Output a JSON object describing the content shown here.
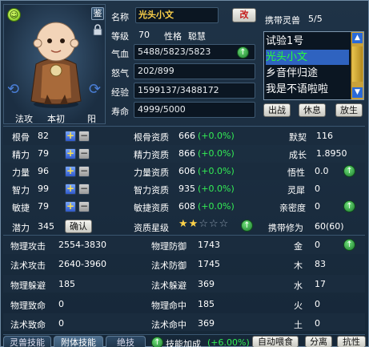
{
  "portrait": {
    "mood_icon": "smiley-face-icon",
    "appraise_char": "鉴",
    "lock_icon": "lock-icon"
  },
  "pet_labels": {
    "left": "法攻",
    "center": "本初",
    "right": "阳"
  },
  "info": {
    "name_label": "名称",
    "name_value": "光头小文",
    "rename_btn": "改",
    "level_label": "等级",
    "level_value": "70",
    "personality_label": "性格",
    "personality_value": "聪慧",
    "hp_label": "气血",
    "hp_value": "5488/5823/5823",
    "anger_label": "怒气",
    "anger_value": "202/899",
    "exp_label": "经验",
    "exp_value": "1599137/3488172",
    "life_label": "寿命",
    "life_value": "4999/5000"
  },
  "carry": {
    "label": "携带灵兽",
    "count": "5/5",
    "items": [
      "试验1号",
      "光头小文",
      "乡音伴归途",
      "我是不语啦啦"
    ],
    "selected": 1
  },
  "carry_buttons": {
    "battle": "出战",
    "rest": "休息",
    "release": "放生"
  },
  "attrs": [
    {
      "name": "根骨",
      "value": "82"
    },
    {
      "name": "精力",
      "value": "79"
    },
    {
      "name": "力量",
      "value": "96"
    },
    {
      "name": "智力",
      "value": "99"
    },
    {
      "name": "敏捷",
      "value": "79"
    }
  ],
  "aptitudes": [
    {
      "name": "根骨资质",
      "value": "666",
      "delta": "(+0.0%)"
    },
    {
      "name": "精力资质",
      "value": "866",
      "delta": "(+0.0%)"
    },
    {
      "name": "力量资质",
      "value": "606",
      "delta": "(+0.0%)"
    },
    {
      "name": "智力资质",
      "value": "935",
      "delta": "(+0.0%)"
    },
    {
      "name": "敏捷资质",
      "value": "608",
      "delta": "(+0.0%)"
    }
  ],
  "right_stats": [
    {
      "name": "默契",
      "value": "116"
    },
    {
      "name": "成长",
      "value": "1.8950"
    },
    {
      "name": "悟性",
      "value": "0.0"
    },
    {
      "name": "灵犀",
      "value": "0"
    },
    {
      "name": "亲密度",
      "value": "0"
    }
  ],
  "potential": {
    "label": "潜力",
    "value": "345",
    "confirm": "确认"
  },
  "star_level": {
    "label": "资质星级",
    "filled": 2,
    "total": 5
  },
  "carry_cultivation": {
    "label": "携带修为",
    "value": "60(60)"
  },
  "combat": [
    {
      "left_name": "物理攻击",
      "left_value": "2554-3830",
      "mid_name": "物理防御",
      "mid_value": "1743",
      "el_name": "金",
      "el_value": "0"
    },
    {
      "left_name": "法术攻击",
      "left_value": "2640-3960",
      "mid_name": "法术防御",
      "mid_value": "1745",
      "el_name": "木",
      "el_value": "83"
    },
    {
      "left_name": "物理躲避",
      "left_value": "185",
      "mid_name": "法术躲避",
      "mid_value": "369",
      "el_name": "水",
      "el_value": "17"
    },
    {
      "left_name": "物理致命",
      "left_value": "0",
      "mid_name": "物理命中",
      "mid_value": "185",
      "el_name": "火",
      "el_value": "0"
    },
    {
      "left_name": "法术致命",
      "left_value": "0",
      "mid_name": "法术命中",
      "mid_value": "369",
      "el_name": "土",
      "el_value": "0"
    }
  ],
  "tabs": [
    "灵兽技能",
    "附体技能",
    "绝技"
  ],
  "bottom": {
    "skill_bonus": "技能加成",
    "skill_bonus_value": "(+6.00%)",
    "auto_feed": "自动喂食",
    "separate": "分离",
    "resist": "抗性"
  },
  "colors": {
    "accent_green": "#33ee55",
    "highlight_yellow": "#ffd24a",
    "panel_bg": "#1f3347"
  }
}
